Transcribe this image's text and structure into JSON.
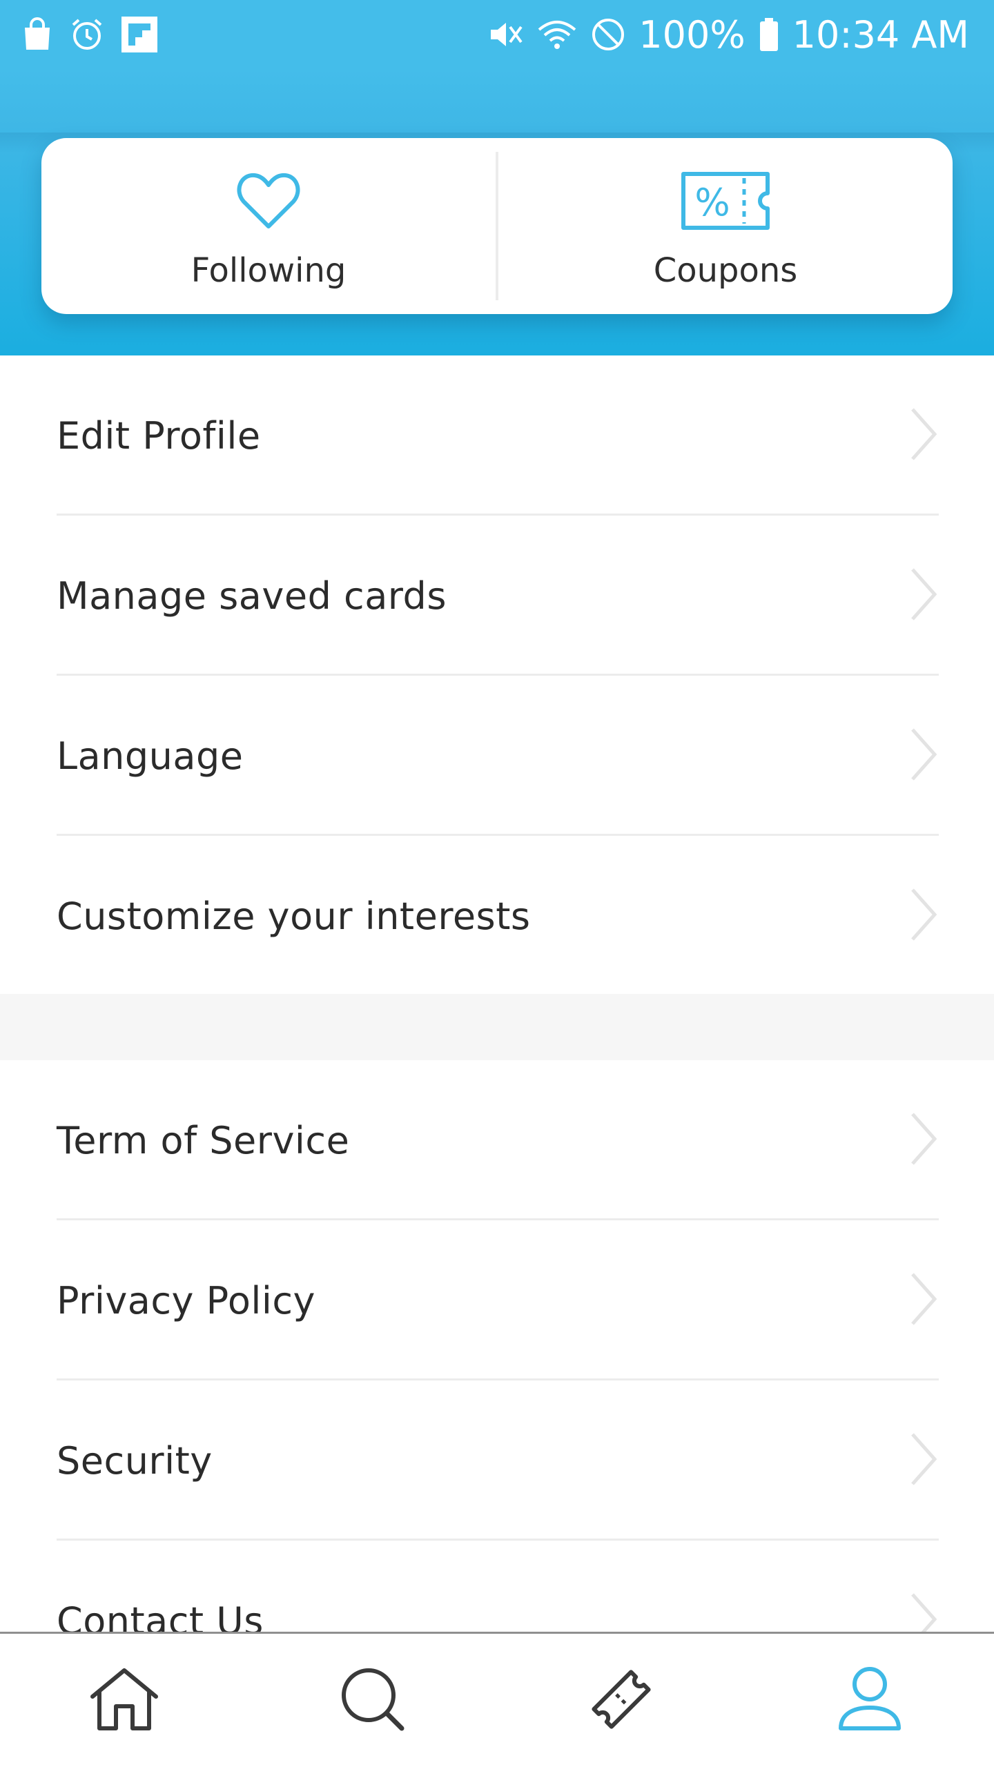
{
  "status_bar": {
    "battery": "100%",
    "time": "10:34 AM",
    "left_icons": [
      "shopping-bag-icon",
      "alarm-icon",
      "flipboard-icon"
    ],
    "right_icons": [
      "vibrate-icon",
      "wifi-icon",
      "do-not-disturb-icon",
      "battery-icon"
    ]
  },
  "quick_actions": [
    {
      "label": "Following",
      "icon": "heart-icon"
    },
    {
      "label": "Coupons",
      "icon": "coupon-icon"
    }
  ],
  "menu_group_1": [
    {
      "label": "Edit Profile"
    },
    {
      "label": "Manage saved cards"
    },
    {
      "label": "Language"
    },
    {
      "label": "Customize your interests"
    }
  ],
  "menu_group_2": [
    {
      "label": "Term of Service"
    },
    {
      "label": "Privacy Policy"
    },
    {
      "label": "Security"
    },
    {
      "label": "Contact Us"
    }
  ],
  "bottom_nav": [
    {
      "name": "home",
      "icon": "home-icon",
      "active": false
    },
    {
      "name": "search",
      "icon": "search-icon",
      "active": false
    },
    {
      "name": "tickets",
      "icon": "ticket-icon",
      "active": false
    },
    {
      "name": "profile",
      "icon": "profile-icon",
      "active": true
    }
  ],
  "colors": {
    "accent": "#44bdea",
    "header_dark": "#1baee0",
    "icon_blue": "#3fb9e6",
    "text": "#2b2b2b",
    "nav_inactive": "#3a3a3a"
  }
}
